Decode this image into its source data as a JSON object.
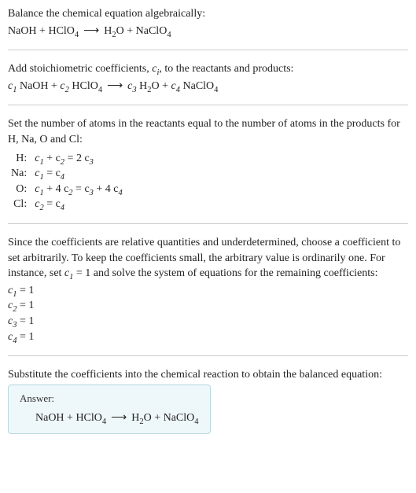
{
  "intro": {
    "title": "Balance the chemical equation algebraically:",
    "reactant1": "NaOH",
    "plus": " + ",
    "reactant2": "HClO",
    "reactant2_sub": "4",
    "arrow": "⟶",
    "product1": "H",
    "product1_sub": "2",
    "product1b": "O",
    "product2": "NaClO",
    "product2_sub": "4"
  },
  "step1": {
    "text_a": "Add stoichiometric coefficients, ",
    "ci": "c",
    "ci_sub": "i",
    "text_b": ", to the reactants and products:",
    "c1": "c",
    "c1_sub": "1",
    "sp1": " NaOH + ",
    "c2": "c",
    "c2_sub": "2",
    "sp2": " HClO",
    "sp2_sub": "4",
    "arrow": "⟶",
    "c3": "c",
    "c3_sub": "3",
    "sp3": " H",
    "sp3_sub": "2",
    "sp3b": "O + ",
    "c4": "c",
    "c4_sub": "4",
    "sp4": " NaClO",
    "sp4_sub": "4"
  },
  "step2": {
    "text": "Set the number of atoms in the reactants equal to the number of atoms in the products for H, Na, O and Cl:",
    "rows": [
      {
        "el": "H:",
        "lhs_a": "c",
        "lhs_a_sub": "1",
        "lhs_b": " + c",
        "lhs_b_sub": "2",
        "eq": " = 2 c",
        "rhs_sub": "3"
      },
      {
        "el": "Na:",
        "lhs_a": "c",
        "lhs_a_sub": "1",
        "lhs_b": "",
        "lhs_b_sub": "",
        "eq": " = c",
        "rhs_sub": "4"
      },
      {
        "el": "O:",
        "lhs_a": "c",
        "lhs_a_sub": "1",
        "lhs_b": " + 4 c",
        "lhs_b_sub": "2",
        "eq": " = c",
        "rhs_sub": "3",
        "extra": " + 4 c",
        "extra_sub": "4"
      },
      {
        "el": "Cl:",
        "lhs_a": "c",
        "lhs_a_sub": "2",
        "lhs_b": "",
        "lhs_b_sub": "",
        "eq": " = c",
        "rhs_sub": "4"
      }
    ]
  },
  "step3": {
    "text_a": "Since the coefficients are relative quantities and underdetermined, choose a coefficient to set arbitrarily. To keep the coefficients small, the arbitrary value is ordinarily one. For instance, set ",
    "c1": "c",
    "c1_sub": "1",
    "text_b": " = 1 and solve the system of equations for the remaining coefficients:",
    "coefs": [
      {
        "c": "c",
        "sub": "1",
        "val": " = 1"
      },
      {
        "c": "c",
        "sub": "2",
        "val": " = 1"
      },
      {
        "c": "c",
        "sub": "3",
        "val": " = 1"
      },
      {
        "c": "c",
        "sub": "4",
        "val": " = 1"
      }
    ]
  },
  "step4": {
    "text": "Substitute the coefficients into the chemical reaction to obtain the balanced equation:"
  },
  "answer": {
    "label": "Answer:",
    "reactant1": "NaOH + HClO",
    "r_sub": "4",
    "arrow": "⟶",
    "product1": "H",
    "p1_sub": "2",
    "product1b": "O + NaClO",
    "p2_sub": "4"
  }
}
